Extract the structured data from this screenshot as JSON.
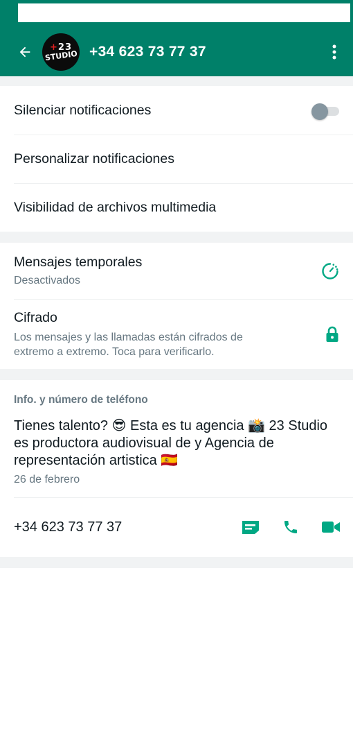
{
  "header": {
    "title": "+34 623 73 77 37",
    "avatar_logo_top": "23",
    "avatar_logo_bottom": "STUDIO",
    "back_icon": "arrow-left-icon",
    "menu_icon": "more-vertical-icon"
  },
  "notifications": {
    "mute_label": "Silenciar notificaciones",
    "mute_enabled": false,
    "custom_label": "Personalizar notificaciones",
    "media_visibility_label": "Visibilidad de archivos multimedia"
  },
  "privacy": {
    "disappearing_title": "Mensajes temporales",
    "disappearing_status": "Desactivados",
    "encryption_title": "Cifrado",
    "encryption_desc": "Los mensajes y las llamadas están cifrados de extremo a extremo. Toca para verificarlo."
  },
  "info": {
    "section_title": "Info. y número de teléfono",
    "about_text": "Tienes talento? 😎 Esta es tu agencia 📸 23 Studio es productora audiovisual de y Agencia de representación artistica 🇪🇸",
    "about_date": "26 de febrero",
    "phone": "+34 623 73 77 37"
  },
  "colors": {
    "accent": "#008069",
    "icon_green": "#00a884",
    "secondary_text": "#667781"
  }
}
